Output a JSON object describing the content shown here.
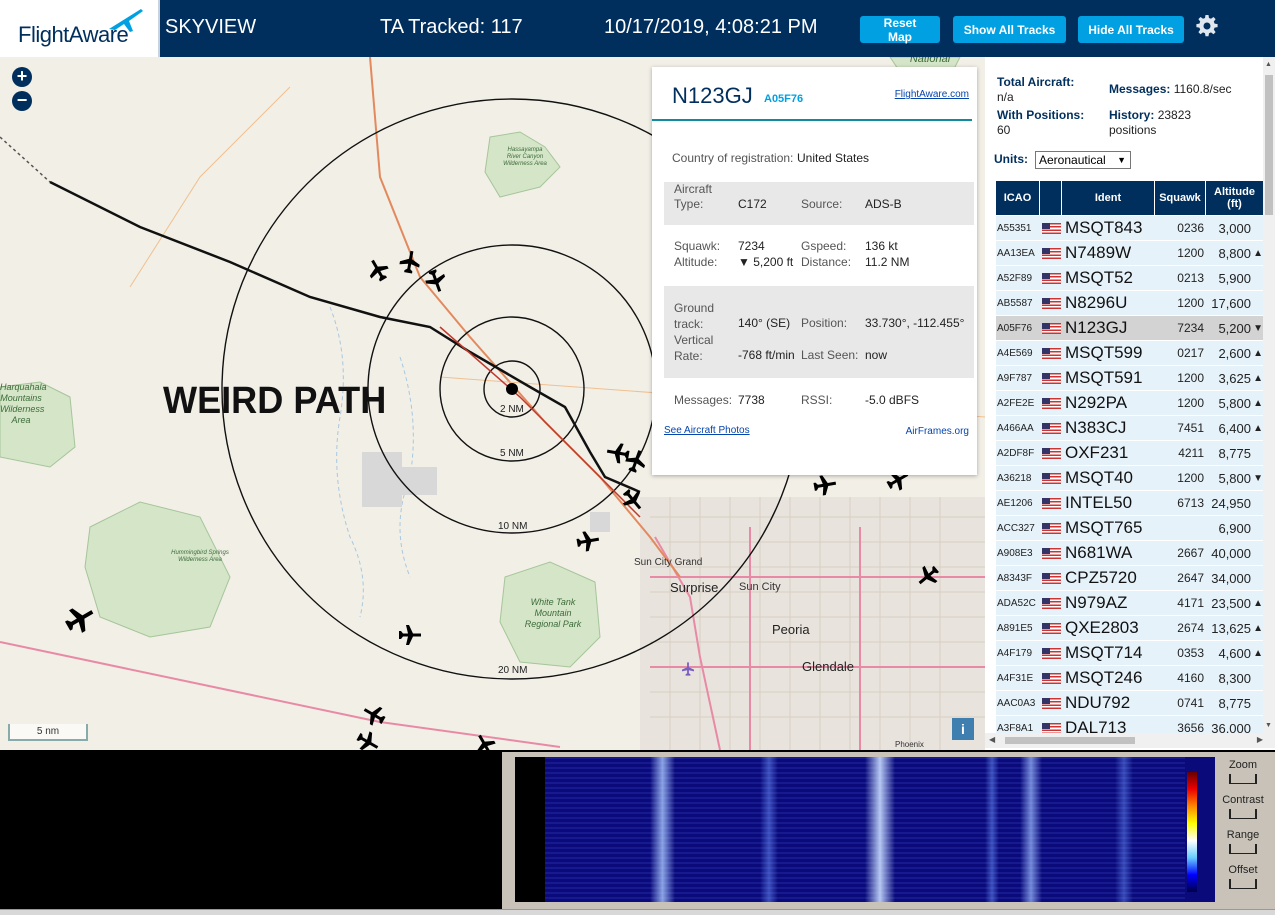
{
  "header": {
    "logo_text": "FlightAware",
    "app_name": "SKYVIEW",
    "tracked": "TA Tracked: 117",
    "datetime": "10/17/2019, 4:08:21 PM",
    "buttons": {
      "reset": "Reset Map",
      "show": "Show All Tracks",
      "hide": "Hide All Tracks"
    },
    "colors": {
      "bar": "#002f5d",
      "button": "#00a0e2"
    }
  },
  "map": {
    "annotation": "WEIRD PATH",
    "zoom_in": "+",
    "zoom_out": "−",
    "rings": [
      "2 NM",
      "5 NM",
      "10 NM",
      "20 NM"
    ],
    "cities": [
      "Sun City Grand",
      "Surprise",
      "Sun City",
      "Peoria",
      "Glendale",
      "Phoenix"
    ],
    "parks": [
      "Hassayampa River Canyon Wilderness Area",
      "Hummingbird Springs Wilderness Area",
      "White Tank Mountain Regional Park",
      "Harquahala Mountains Wilderness Area",
      "National"
    ],
    "scale": "5 nm",
    "info": "i"
  },
  "popup": {
    "ident": "N123GJ",
    "hex": "A05F76",
    "link": "FlightAware.com",
    "country_label": "Country of registration:",
    "country": "United States",
    "aircraft_type_label": "Aircraft Type:",
    "aircraft_type": "C172",
    "source_label": "Source:",
    "source": "ADS-B",
    "squawk_label": "Squawk:",
    "squawk": "7234",
    "gspeed_label": "Gspeed:",
    "gspeed": "136 kt",
    "altitude_label": "Altitude:",
    "altitude": "▼ 5,200 ft",
    "distance_label": "Distance:",
    "distance": "11.2 NM",
    "track_label": "Ground track:",
    "track": "140° (SE)",
    "position_label": "Position:",
    "position": "33.730°, -112.455°",
    "vrate_label": "Vertical Rate:",
    "vrate": "-768 ft/min",
    "lastseen_label": "Last Seen:",
    "lastseen": "now",
    "messages_label": "Messages:",
    "messages": "7738",
    "rssi_label": "RSSI:",
    "rssi": "-5.0 dBFS",
    "photos_link": "See Aircraft Photos",
    "airframes_link": "AirFrames.org"
  },
  "stats": {
    "total_label": "Total Aircraft:",
    "total": "n/a",
    "messages_label": "Messages:",
    "messages": "1160.8/sec",
    "positions_label": "With Positions:",
    "positions": "60",
    "history_label": "History:",
    "history": "23823 positions",
    "units_label": "Units:",
    "units": "Aeronautical"
  },
  "table": {
    "headers": [
      "ICAO",
      "",
      "Ident",
      "Squawk",
      "Altitude (ft)"
    ],
    "rows": [
      {
        "icao": "A55351",
        "ident": "MSQT843",
        "squawk": "0236",
        "alt": "3,000",
        "arrow": ""
      },
      {
        "icao": "AA13EA",
        "ident": "N7489W",
        "squawk": "1200",
        "alt": "8,800",
        "arrow": "▲"
      },
      {
        "icao": "A52F89",
        "ident": "MSQT52",
        "squawk": "0213",
        "alt": "5,900",
        "arrow": ""
      },
      {
        "icao": "AB5587",
        "ident": "N8296U",
        "squawk": "1200",
        "alt": "17,600",
        "arrow": ""
      },
      {
        "icao": "A05F76",
        "ident": "N123GJ",
        "squawk": "7234",
        "alt": "5,200",
        "arrow": "▼",
        "selected": true
      },
      {
        "icao": "A4E569",
        "ident": "MSQT599",
        "squawk": "0217",
        "alt": "2,600",
        "arrow": "▲"
      },
      {
        "icao": "A9F787",
        "ident": "MSQT591",
        "squawk": "1200",
        "alt": "3,625",
        "arrow": "▲"
      },
      {
        "icao": "A2FE2E",
        "ident": "N292PA",
        "squawk": "1200",
        "alt": "5,800",
        "arrow": "▲"
      },
      {
        "icao": "A466AA",
        "ident": "N383CJ",
        "squawk": "7451",
        "alt": "6,400",
        "arrow": "▲"
      },
      {
        "icao": "A2DF8F",
        "ident": "OXF231",
        "squawk": "4211",
        "alt": "8,775",
        "arrow": ""
      },
      {
        "icao": "A36218",
        "ident": "MSQT40",
        "squawk": "1200",
        "alt": "5,800",
        "arrow": "▼"
      },
      {
        "icao": "AE1206",
        "ident": "INTEL50",
        "squawk": "6713",
        "alt": "24,950",
        "arrow": ""
      },
      {
        "icao": "ACC327",
        "ident": "MSQT765",
        "squawk": "",
        "alt": "6,900",
        "arrow": ""
      },
      {
        "icao": "A908E3",
        "ident": "N681WA",
        "squawk": "2667",
        "alt": "40,000",
        "arrow": ""
      },
      {
        "icao": "A8343F",
        "ident": "CPZ5720",
        "squawk": "2647",
        "alt": "34,000",
        "arrow": ""
      },
      {
        "icao": "ADA52C",
        "ident": "N979AZ",
        "squawk": "4171",
        "alt": "23,500",
        "arrow": "▲"
      },
      {
        "icao": "A891E5",
        "ident": "QXE2803",
        "squawk": "2674",
        "alt": "13,625",
        "arrow": "▲"
      },
      {
        "icao": "A4F179",
        "ident": "MSQT714",
        "squawk": "0353",
        "alt": "4,600",
        "arrow": "▲"
      },
      {
        "icao": "A4F31E",
        "ident": "MSQT246",
        "squawk": "4160",
        "alt": "8,300",
        "arrow": ""
      },
      {
        "icao": "AAC0A3",
        "ident": "NDU792",
        "squawk": "0741",
        "alt": "8,775",
        "arrow": ""
      },
      {
        "icao": "A3F8A1",
        "ident": "DAL713",
        "squawk": "3656",
        "alt": "36,000",
        "arrow": ""
      }
    ]
  },
  "waterfall": {
    "controls": [
      "Zoom",
      "Contrast",
      "Range",
      "Offset"
    ]
  }
}
